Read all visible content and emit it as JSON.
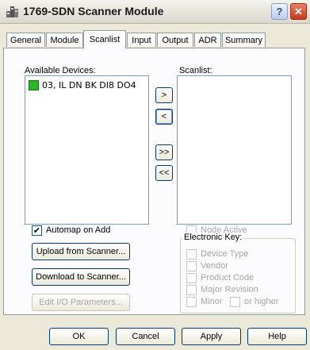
{
  "window": {
    "title": "1769-SDN Scanner Module",
    "help_label": "?",
    "close_label": "✕"
  },
  "tabs": [
    {
      "label": "General"
    },
    {
      "label": "Module"
    },
    {
      "label": "Scanlist"
    },
    {
      "label": "Input"
    },
    {
      "label": "Output"
    },
    {
      "label": "ADR"
    },
    {
      "label": "Summary"
    }
  ],
  "active_tab": "Scanlist",
  "available": {
    "label": "Available Devices:",
    "items": [
      {
        "label": "03, IL DN BK DI8 DO4",
        "icon": "device-icon"
      }
    ]
  },
  "scanlist": {
    "label": "Scanlist:",
    "items": []
  },
  "transfer": {
    "add": ">",
    "remove": "<",
    "add_all": ">>",
    "remove_all": "<<"
  },
  "automap": {
    "label": "Automap on Add",
    "checked": true
  },
  "buttons": {
    "upload": "Upload from Scanner...",
    "download": "Download to Scanner...",
    "edit_io": "Edit I/O Parameters..."
  },
  "node_active": {
    "label": "Node Active",
    "checked": false,
    "enabled": false
  },
  "electronic_key": {
    "title": "Electronic Key:",
    "device_type": "Device Type",
    "vendor": "Vendor",
    "product_code": "Product Code",
    "major_revision": "Major Revision",
    "minor": "Minor",
    "or_higher": "or higher"
  },
  "footer": {
    "ok": "OK",
    "cancel": "Cancel",
    "apply": "Apply",
    "help": "Help"
  }
}
